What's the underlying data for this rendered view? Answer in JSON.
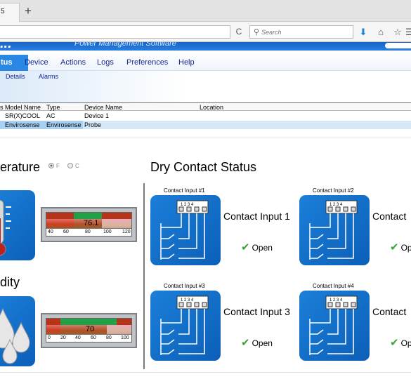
{
  "browser": {
    "tab_title": "5",
    "new_tab": "+",
    "reload": "C",
    "search_placeholder": "Search",
    "icons": [
      "download-icon",
      "home-icon",
      "bookmark-star-icon"
    ]
  },
  "app": {
    "brand": "...",
    "subtitle": "Power Management Software",
    "menu": [
      "tus",
      "Device",
      "Actions",
      "Logs",
      "Preferences",
      "Help"
    ],
    "active_menu": "tus",
    "submenu": [
      "Details",
      "Alarms"
    ]
  },
  "devices": {
    "columns": [
      "s",
      "Model Name",
      "Type",
      "Device Name",
      "Location"
    ],
    "rows": [
      {
        "model": "SR(X)COOL",
        "type": "AC",
        "name": "Device 1",
        "location": ""
      },
      {
        "model": "Envirosense",
        "type": "Envirosense",
        "name": "Probe",
        "location": ""
      }
    ]
  },
  "temperature": {
    "title": "erature",
    "units": [
      "F",
      "C"
    ],
    "selected_unit": "F",
    "value": "76.1",
    "scale": [
      "40",
      "60",
      "80",
      "100",
      "120"
    ]
  },
  "humidity": {
    "title": "dity",
    "value": "70",
    "scale": [
      "0",
      "20",
      "40",
      "60",
      "80",
      "100"
    ]
  },
  "dry_contact": {
    "title": "Dry Contact Status",
    "inputs": [
      {
        "label": "Contact Input #1",
        "name": "Contact Input 1",
        "status": "Open"
      },
      {
        "label": "Contact Input #2",
        "name": "Contact",
        "status": "Op"
      },
      {
        "label": "Contact Input #3",
        "name": "Contact Input 3",
        "status": "Open"
      },
      {
        "label": "Contact Input #4",
        "name": "Contact",
        "status": "Op"
      }
    ]
  },
  "colors": {
    "accent": "#2a87e3",
    "tile": "#1b7fd8",
    "gauge_red": "#b5341a",
    "gauge_green": "#21a248",
    "ok_green": "#3aa534"
  }
}
